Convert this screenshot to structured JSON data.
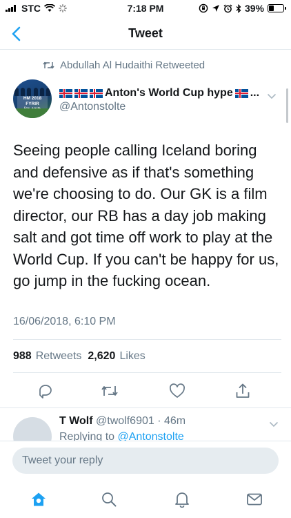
{
  "status_bar": {
    "carrier": "STC",
    "time": "7:18 PM",
    "battery": "39%",
    "battery_level": 0.39
  },
  "nav": {
    "title": "Tweet"
  },
  "tweet": {
    "retweeted_by": "Abdullah Al Hudaithi Retweeted",
    "avatar_badge": "HM 2018 FYRIR ÍSLAND",
    "display_name": "Anton's World Cup hype",
    "display_name_suffix": "...",
    "handle": "@Antonstolte",
    "text": "Seeing people calling Iceland boring and defensive as if that's something we're choosing to do. Our GK is a film director, our RB has a day job making salt and got time off work to play at the World Cup. If you can't be happy for us, go jump in the fucking ocean.",
    "timestamp": "16/06/2018, 6:10 PM",
    "retweets_count": "988",
    "retweets_label": "Retweets",
    "likes_count": "2,620",
    "likes_label": "Likes"
  },
  "reply": {
    "name": "T Wolf",
    "meta": "@twolf6901 · 46m",
    "replying_prefix": "Replying to ",
    "replying_to": "@Antonstolte"
  },
  "composer": {
    "placeholder": "Tweet your reply"
  },
  "icons": {
    "back": "chevron-left-icon",
    "retweet": "retweet-icon",
    "reply": "reply-icon",
    "like": "heart-icon",
    "share": "share-icon",
    "home": "home-icon",
    "search": "search-icon",
    "notifications": "bell-icon",
    "messages": "mail-icon"
  },
  "colors": {
    "accent": "#1da1f2",
    "muted": "#657786",
    "text": "#14171a"
  }
}
